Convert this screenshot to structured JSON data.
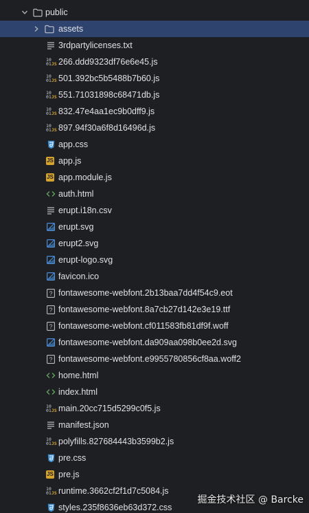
{
  "tree": {
    "root": {
      "label": "public",
      "expanded": true
    },
    "items": [
      {
        "label": "assets",
        "icon": "folder-icon",
        "kind": "folder",
        "selected": true,
        "collapsed": true
      },
      {
        "label": "3rdpartylicenses.txt",
        "icon": "text-file-icon",
        "kind": "text"
      },
      {
        "label": "266.ddd9323df76e6e45.js",
        "icon": "minified-js-icon",
        "kind": "min"
      },
      {
        "label": "501.392bc5b5488b7b60.js",
        "icon": "minified-js-icon",
        "kind": "min"
      },
      {
        "label": "551.71031898c68471db.js",
        "icon": "minified-js-icon",
        "kind": "min"
      },
      {
        "label": "832.47e4aa1ec9b0dff9.js",
        "icon": "minified-js-icon",
        "kind": "min"
      },
      {
        "label": "897.94f30a6f8d16496d.js",
        "icon": "minified-js-icon",
        "kind": "min"
      },
      {
        "label": "app.css",
        "icon": "css-file-icon",
        "kind": "css"
      },
      {
        "label": "app.js",
        "icon": "js-file-icon",
        "kind": "js"
      },
      {
        "label": "app.module.js",
        "icon": "js-file-icon",
        "kind": "js"
      },
      {
        "label": "auth.html",
        "icon": "html-file-icon",
        "kind": "html"
      },
      {
        "label": "erupt.i18n.csv",
        "icon": "text-file-icon",
        "kind": "text"
      },
      {
        "label": "erupt.svg",
        "icon": "image-file-icon",
        "kind": "svg"
      },
      {
        "label": "erupt2.svg",
        "icon": "image-file-icon",
        "kind": "svg"
      },
      {
        "label": "erupt-logo.svg",
        "icon": "image-file-icon",
        "kind": "svg"
      },
      {
        "label": "favicon.ico",
        "icon": "image-file-icon",
        "kind": "svg"
      },
      {
        "label": "fontawesome-webfont.2b13baa7dd4f54c9.eot",
        "icon": "unknown-file-icon",
        "kind": "unknown"
      },
      {
        "label": "fontawesome-webfont.8a7cb27d142e3e19.ttf",
        "icon": "unknown-file-icon",
        "kind": "unknown"
      },
      {
        "label": "fontawesome-webfont.cf011583fb81df9f.woff",
        "icon": "unknown-file-icon",
        "kind": "unknown"
      },
      {
        "label": "fontawesome-webfont.da909aa098b0ee2d.svg",
        "icon": "image-file-icon",
        "kind": "svg"
      },
      {
        "label": "fontawesome-webfont.e9955780856cf8aa.woff2",
        "icon": "unknown-file-icon",
        "kind": "unknown"
      },
      {
        "label": "home.html",
        "icon": "html-file-icon",
        "kind": "html"
      },
      {
        "label": "index.html",
        "icon": "html-file-icon",
        "kind": "html"
      },
      {
        "label": "main.20cc715d5299c0f5.js",
        "icon": "minified-js-icon",
        "kind": "min"
      },
      {
        "label": "manifest.json",
        "icon": "text-file-icon",
        "kind": "text"
      },
      {
        "label": "polyfills.827684443b3599b2.js",
        "icon": "minified-js-icon",
        "kind": "min"
      },
      {
        "label": "pre.css",
        "icon": "css-file-icon",
        "kind": "css"
      },
      {
        "label": "pre.js",
        "icon": "js-file-icon",
        "kind": "js"
      },
      {
        "label": "runtime.3662cf2f1d7c5084.js",
        "icon": "minified-js-icon",
        "kind": "min"
      },
      {
        "label": "styles.235f8636eb63d372.css",
        "icon": "css-file-icon",
        "kind": "css"
      }
    ]
  },
  "min_icon_text": {
    "line1": "10",
    "line2a": "01",
    "line2b": "JS"
  },
  "js_icon_text": "JS",
  "watermark": "掘金技术社区 @ Barcke",
  "colors": {
    "background": "#1e1f22",
    "selection": "#2e436e",
    "text": "#dfe1e5",
    "js_yellow": "#d6a42c",
    "css_blue": "#3d8fd1",
    "html_green": "#5fa35b",
    "svg_blue": "#4b8fd6"
  }
}
